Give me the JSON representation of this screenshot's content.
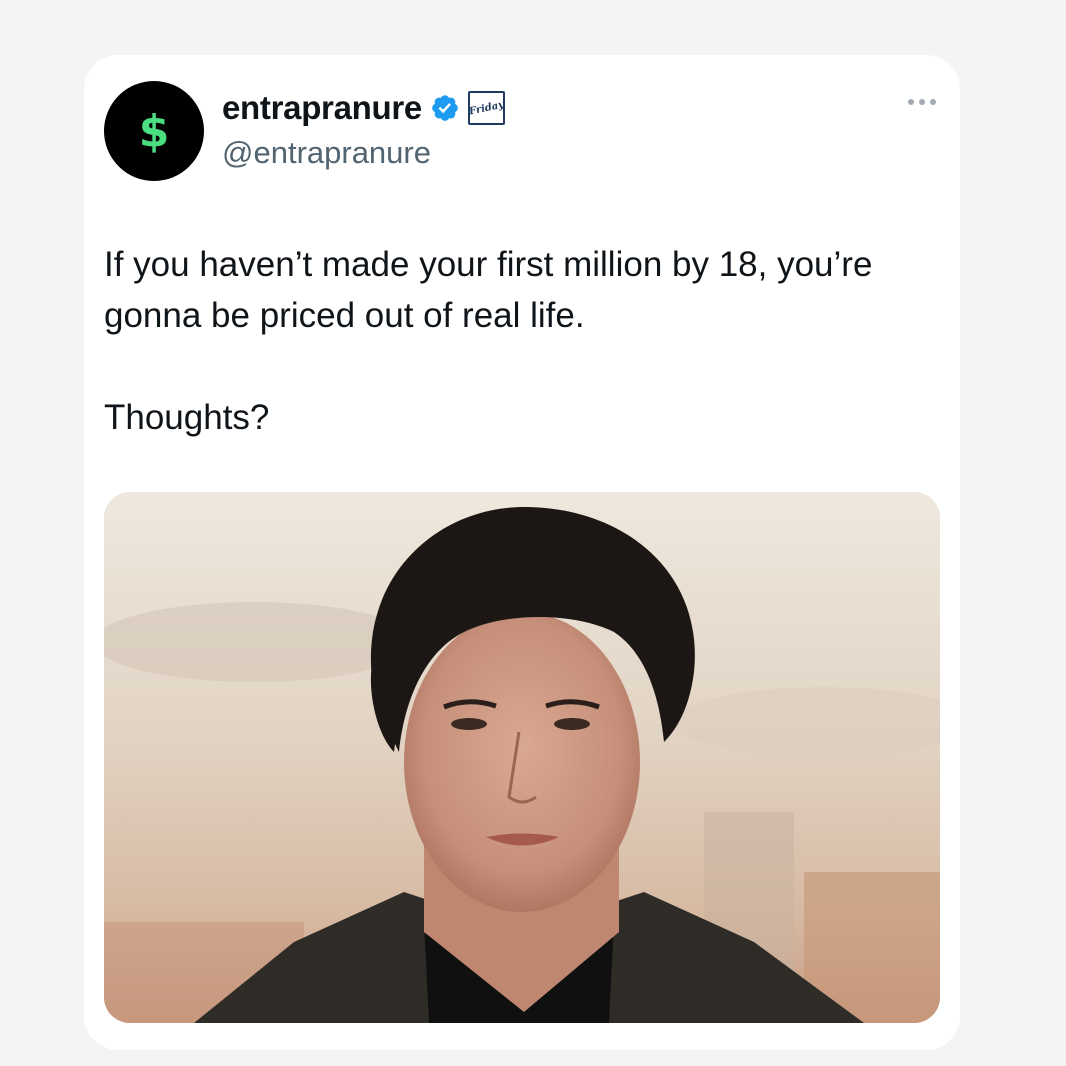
{
  "tweet": {
    "avatar_symbol": "$",
    "display_name": "entrapranure",
    "handle": "@entrapranure",
    "affiliate_badge_text": "Friday",
    "verified": true,
    "more_icon": "more-horizontal-icon",
    "text": "If you haven’t made your first million by 18, you’re\ngonna be priced out of real life.\n\nThoughts?"
  },
  "colors": {
    "avatar_bg": "#000000",
    "avatar_symbol": "#4ade80",
    "verified_badge": "#1d9bf0",
    "handle": "#536471",
    "text": "#0f1419"
  }
}
